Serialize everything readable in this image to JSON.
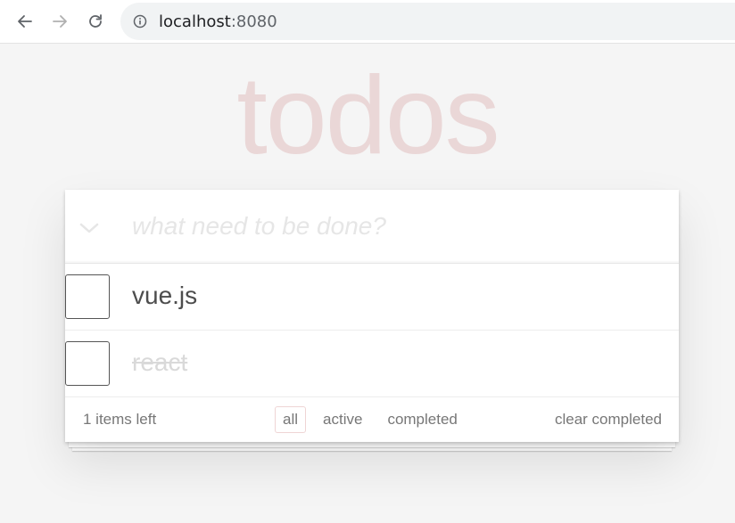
{
  "browser": {
    "url_host": "localhost",
    "url_port": ":8080",
    "icons": {
      "back": "back-arrow-icon",
      "forward": "forward-arrow-icon",
      "reload": "reload-icon",
      "info": "info-icon"
    }
  },
  "app": {
    "title": "todos",
    "title_color": "#af2f2f",
    "new_todo_placeholder": "what need to be done?",
    "todos": [
      {
        "label": "vue.js",
        "completed": false
      },
      {
        "label": "react",
        "completed": true
      }
    ],
    "footer": {
      "items_left": "1 items left",
      "filters": [
        "all",
        "active",
        "completed"
      ],
      "selected_filter": "all",
      "clear_completed": "clear completed"
    }
  }
}
